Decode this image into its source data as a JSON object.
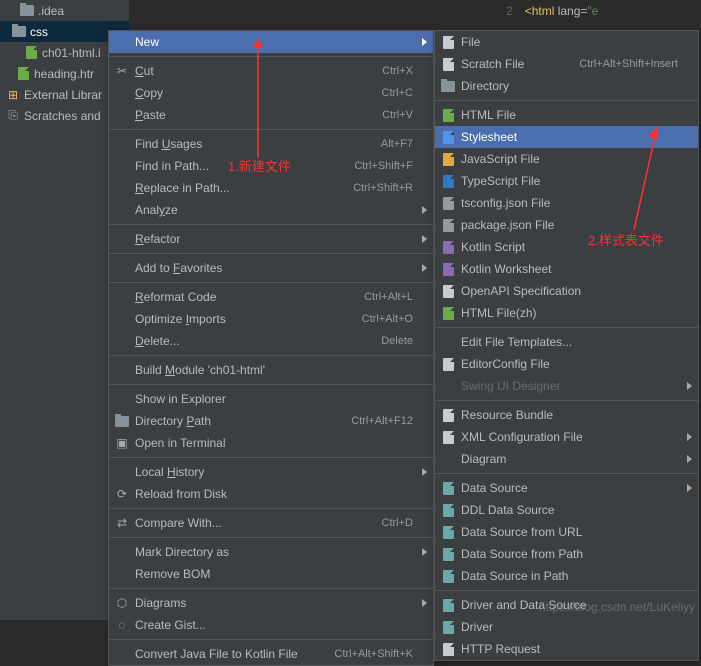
{
  "tree": {
    "items": [
      {
        "label": ".idea",
        "indent": 20,
        "selected": false,
        "type": "folder",
        "expand": "right"
      },
      {
        "label": "css",
        "indent": 12,
        "selected": true,
        "type": "folder"
      },
      {
        "label": "ch01-html.i",
        "indent": 24,
        "selected": false,
        "type": "file-html"
      },
      {
        "label": "heading.htr",
        "indent": 16,
        "selected": false,
        "type": "file-html"
      },
      {
        "label": "External Librar",
        "indent": 6,
        "selected": false,
        "type": "lib"
      },
      {
        "label": "Scratches and",
        "indent": 6,
        "selected": false,
        "type": "scratch"
      }
    ]
  },
  "editor": {
    "line": "2",
    "code_prefix": "<",
    "code_tag": "html",
    "code_attr": " lang",
    "code_eq": "=",
    "code_str": "\"e"
  },
  "menu1": [
    {
      "type": "item",
      "label": "New",
      "hover": true,
      "arrow": true,
      "icon": null,
      "annotHint": true
    },
    {
      "type": "sep"
    },
    {
      "type": "item",
      "label": "Cut",
      "sc": "Ctrl+X",
      "icon": "cut",
      "u": true
    },
    {
      "type": "item",
      "label": "Copy",
      "sc": "Ctrl+C",
      "u": 0
    },
    {
      "type": "item",
      "label": "Paste",
      "sc": "Ctrl+V",
      "u": 0
    },
    {
      "type": "sep"
    },
    {
      "type": "item",
      "label": "Find Usages",
      "sc": "Alt+F7",
      "u": 5
    },
    {
      "type": "item",
      "label": "Find in Path...",
      "sc": "Ctrl+Shift+F"
    },
    {
      "type": "item",
      "label": "Replace in Path...",
      "sc": "Ctrl+Shift+R",
      "u": 0
    },
    {
      "type": "item",
      "label": "Analyze",
      "arrow": true,
      "u": 4
    },
    {
      "type": "sep"
    },
    {
      "type": "item",
      "label": "Refactor",
      "arrow": true,
      "u": 0
    },
    {
      "type": "sep"
    },
    {
      "type": "item",
      "label": "Add to Favorites",
      "arrow": true,
      "u": 7
    },
    {
      "type": "sep"
    },
    {
      "type": "item",
      "label": "Reformat Code",
      "sc": "Ctrl+Alt+L",
      "u": 0
    },
    {
      "type": "item",
      "label": "Optimize Imports",
      "sc": "Ctrl+Alt+O",
      "u": 9
    },
    {
      "type": "item",
      "label": "Delete...",
      "sc": "Delete",
      "u": 0
    },
    {
      "type": "sep"
    },
    {
      "type": "item",
      "label": "Build Module 'ch01-html'",
      "u": 6
    },
    {
      "type": "sep"
    },
    {
      "type": "item",
      "label": "Show in Explorer"
    },
    {
      "type": "item",
      "label": "Directory Path",
      "sc": "Ctrl+Alt+F12",
      "u": 10,
      "icon": "folder"
    },
    {
      "type": "item",
      "label": "Open in Terminal",
      "icon": "term"
    },
    {
      "type": "sep"
    },
    {
      "type": "item",
      "label": "Local History",
      "arrow": true,
      "u": 6
    },
    {
      "type": "item",
      "label": "Reload from Disk",
      "icon": "reload"
    },
    {
      "type": "sep"
    },
    {
      "type": "item",
      "label": "Compare With...",
      "sc": "Ctrl+D",
      "icon": "compare"
    },
    {
      "type": "sep"
    },
    {
      "type": "item",
      "label": "Mark Directory as",
      "arrow": true
    },
    {
      "type": "item",
      "label": "Remove BOM"
    },
    {
      "type": "sep"
    },
    {
      "type": "item",
      "label": "Diagrams",
      "arrow": true,
      "icon": "diagram"
    },
    {
      "type": "item",
      "label": "Create Gist...",
      "icon": "github"
    },
    {
      "type": "sep"
    },
    {
      "type": "item",
      "label": "Convert Java File to Kotlin File",
      "sc": "Ctrl+Alt+Shift+K"
    }
  ],
  "menu2": [
    {
      "type": "item",
      "label": "File",
      "icon": "file"
    },
    {
      "type": "item",
      "label": "Scratch File",
      "sc": "Ctrl+Alt+Shift+Insert",
      "icon": "file"
    },
    {
      "type": "item",
      "label": "Directory",
      "icon": "folder"
    },
    {
      "type": "sep"
    },
    {
      "type": "item",
      "label": "HTML File",
      "icon": "html"
    },
    {
      "type": "item",
      "label": "Stylesheet",
      "icon": "css",
      "hover": true
    },
    {
      "type": "item",
      "label": "JavaScript File",
      "icon": "js"
    },
    {
      "type": "item",
      "label": "TypeScript File",
      "icon": "ts"
    },
    {
      "type": "item",
      "label": "tsconfig.json File",
      "icon": "json"
    },
    {
      "type": "item",
      "label": "package.json File",
      "icon": "json"
    },
    {
      "type": "item",
      "label": "Kotlin Script",
      "icon": "kt"
    },
    {
      "type": "item",
      "label": "Kotlin Worksheet",
      "icon": "kt"
    },
    {
      "type": "item",
      "label": "OpenAPI Specification",
      "icon": "file"
    },
    {
      "type": "item",
      "label": "HTML File(zh)",
      "icon": "html"
    },
    {
      "type": "sep"
    },
    {
      "type": "item",
      "label": "Edit File Templates..."
    },
    {
      "type": "item",
      "label": "EditorConfig File",
      "icon": "file"
    },
    {
      "type": "item",
      "label": "Swing UI Designer",
      "arrow": true,
      "disabled": true
    },
    {
      "type": "sep"
    },
    {
      "type": "item",
      "label": "Resource Bundle",
      "icon": "bundle"
    },
    {
      "type": "item",
      "label": "XML Configuration File",
      "arrow": true,
      "icon": "xml"
    },
    {
      "type": "item",
      "label": "Diagram",
      "arrow": true
    },
    {
      "type": "sep"
    },
    {
      "type": "item",
      "label": "Data Source",
      "arrow": true,
      "icon": "db"
    },
    {
      "type": "item",
      "label": "DDL Data Source",
      "icon": "db"
    },
    {
      "type": "item",
      "label": "Data Source from URL",
      "icon": "db"
    },
    {
      "type": "item",
      "label": "Data Source from Path",
      "icon": "db"
    },
    {
      "type": "item",
      "label": "Data Source in Path",
      "icon": "db"
    },
    {
      "type": "sep"
    },
    {
      "type": "item",
      "label": "Driver and Data Source",
      "icon": "db"
    },
    {
      "type": "item",
      "label": "Driver",
      "icon": "db"
    },
    {
      "type": "item",
      "label": "HTTP Request",
      "icon": "http"
    }
  ],
  "annotations": {
    "a1": "1.新建文件",
    "a2": "2.样式表文件"
  },
  "watermark": "https://blog.csdn.net/LuKeliyy"
}
